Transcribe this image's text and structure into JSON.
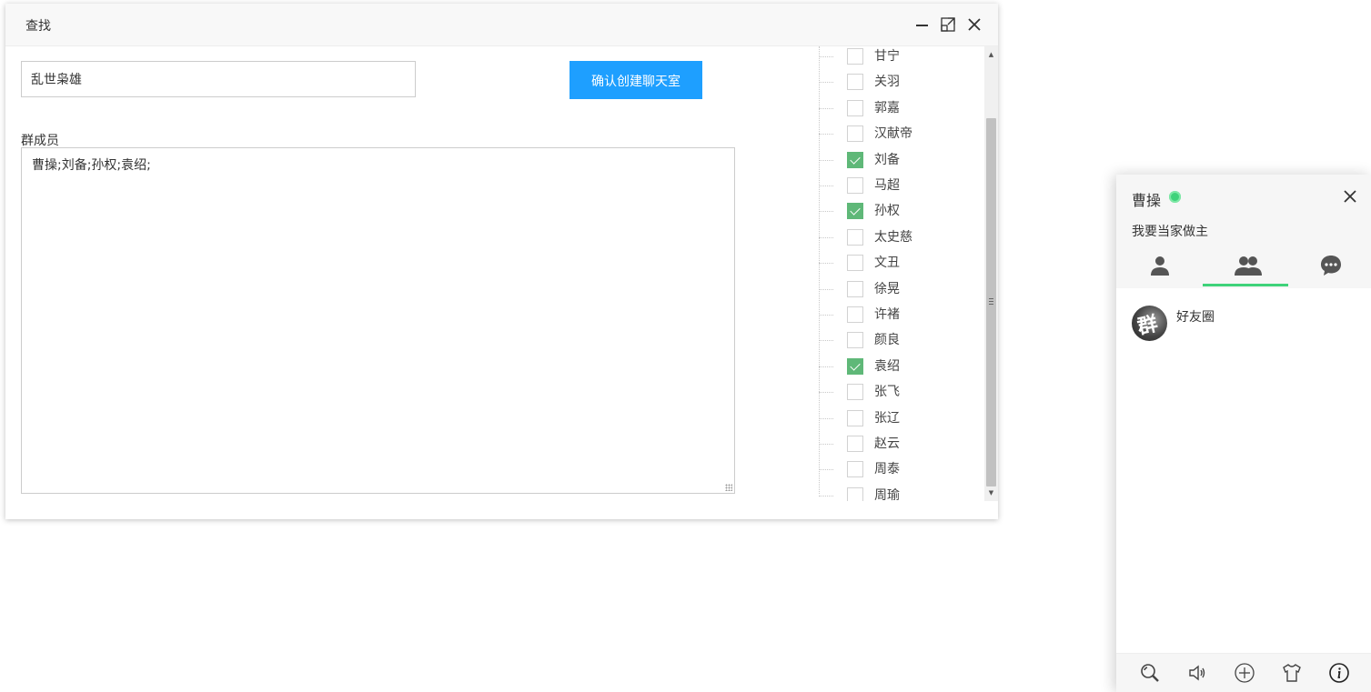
{
  "dialog": {
    "title": "查找",
    "group_name_value": "乱世枭雄",
    "create_button_label": "确认创建聊天室",
    "members_label": "群成员",
    "members_value": "曹操;刘备;孙权;袁绍;"
  },
  "tree": {
    "items": [
      {
        "name": "甘宁",
        "checked": false
      },
      {
        "name": "关羽",
        "checked": false
      },
      {
        "name": "郭嘉",
        "checked": false
      },
      {
        "name": "汉献帝",
        "checked": false
      },
      {
        "name": "刘备",
        "checked": true
      },
      {
        "name": "马超",
        "checked": false
      },
      {
        "name": "孙权",
        "checked": true
      },
      {
        "name": "太史慈",
        "checked": false
      },
      {
        "name": "文丑",
        "checked": false
      },
      {
        "name": "徐晃",
        "checked": false
      },
      {
        "name": "许褚",
        "checked": false
      },
      {
        "name": "颜良",
        "checked": false
      },
      {
        "name": "袁绍",
        "checked": true
      },
      {
        "name": "张飞",
        "checked": false
      },
      {
        "name": "张辽",
        "checked": false
      },
      {
        "name": "赵云",
        "checked": false
      },
      {
        "name": "周泰",
        "checked": false
      },
      {
        "name": "周瑜",
        "checked": false
      }
    ]
  },
  "chat": {
    "username": "曹操",
    "status_color": "#3fd27a",
    "signature": "我要当家做主",
    "tabs": [
      {
        "icon": "user-icon",
        "active": false
      },
      {
        "icon": "group-icon",
        "active": true
      },
      {
        "icon": "chat-bubble-icon",
        "active": false
      }
    ],
    "groups": [
      {
        "avatar_text": "群",
        "name": "好友圈"
      }
    ],
    "footer_icons": [
      "search-icon",
      "speaker-icon",
      "add-icon",
      "skin-icon",
      "info-icon"
    ]
  },
  "colors": {
    "accent_blue": "#1e9fff",
    "check_green": "#5fb878",
    "online_green": "#3fd27a"
  }
}
